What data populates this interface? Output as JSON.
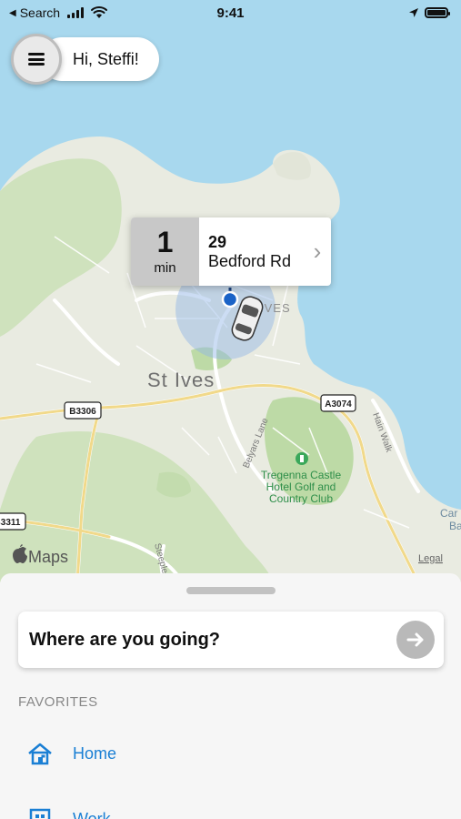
{
  "status_bar": {
    "back_label": "Search",
    "time": "9:41"
  },
  "greeting": {
    "text": "Hi, Steffi!"
  },
  "eta": {
    "minutes": "1",
    "unit": "min",
    "address_number": "29",
    "address_street": "Bedford Rd"
  },
  "map": {
    "town_label": "St Ives",
    "town_partial_label": "IVES",
    "road_b3306": "B3306",
    "road_a3074": "A3074",
    "road_b3311": "B3311",
    "lane_belyars": "Belyars Lane",
    "lane_hain": "Hain Walk",
    "lane_steeple": "Steeple",
    "golf_label_1": "Tregenna Castle",
    "golf_label_2": "Hotel Golf and",
    "golf_label_3": "Country Club",
    "bay_label_1": "Car",
    "bay_label_2": "Ba",
    "maps_brand": "Maps",
    "legal": "Legal"
  },
  "sheet": {
    "search_prompt": "Where are you going?",
    "favorites_heading": "FAVORITES",
    "favorites": [
      {
        "label": "Home",
        "icon": "home-icon"
      },
      {
        "label": "Work",
        "icon": "work-icon"
      }
    ]
  },
  "colors": {
    "water": "#a8d8ee",
    "land": "#e9ebe1",
    "park": "#c7dfb5",
    "accent": "#1a7fd4",
    "location": "#1a63c7"
  }
}
